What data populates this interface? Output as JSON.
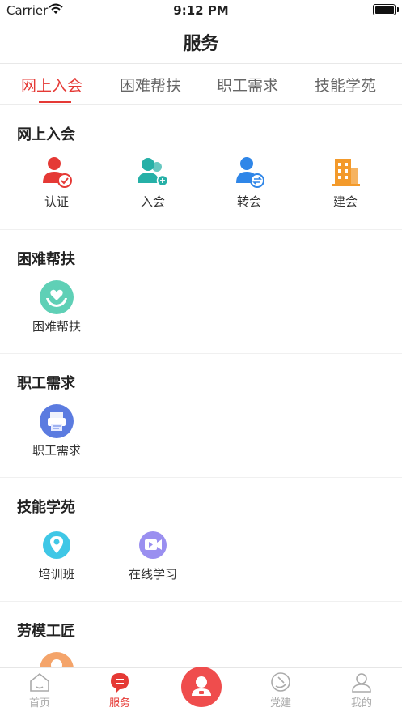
{
  "status_bar": {
    "carrier": "Carrier",
    "time": "9:12 PM"
  },
  "nav": {
    "title": "服务"
  },
  "tabs": [
    {
      "label": "网上入会",
      "active": true
    },
    {
      "label": "困难帮扶",
      "active": false
    },
    {
      "label": "职工需求",
      "active": false
    },
    {
      "label": "技能学苑",
      "active": false
    }
  ],
  "sections": [
    {
      "title": "网上入会",
      "items": [
        {
          "label": "认证",
          "icon": "user-check-icon"
        },
        {
          "label": "入会",
          "icon": "users-add-icon"
        },
        {
          "label": "转会",
          "icon": "user-transfer-icon"
        },
        {
          "label": "建会",
          "icon": "building-icon"
        }
      ]
    },
    {
      "title": "困难帮扶",
      "items": [
        {
          "label": "困难帮扶",
          "icon": "heart-hands-icon"
        }
      ]
    },
    {
      "title": "职工需求",
      "items": [
        {
          "label": "职工需求",
          "icon": "printer-icon"
        }
      ]
    },
    {
      "title": "技能学苑",
      "items": [
        {
          "label": "培训班",
          "icon": "location-pin-icon"
        },
        {
          "label": "在线学习",
          "icon": "video-camera-icon"
        }
      ]
    },
    {
      "title": "劳模工匠",
      "items": [
        {
          "label": "",
          "icon": "worker-avatar-icon"
        }
      ]
    }
  ],
  "tabbar": [
    {
      "label": "首页",
      "icon": "home-icon",
      "active": false
    },
    {
      "label": "服务",
      "icon": "service-icon",
      "active": true
    },
    {
      "label": "",
      "icon": "center-user-icon",
      "active": false
    },
    {
      "label": "党建",
      "icon": "party-emblem-icon",
      "active": false
    },
    {
      "label": "我的",
      "icon": "profile-icon",
      "active": false
    }
  ],
  "colors": {
    "accent": "#e53935",
    "teal": "#26b0a7",
    "blue": "#2f86e8",
    "orange": "#f39a2b"
  }
}
